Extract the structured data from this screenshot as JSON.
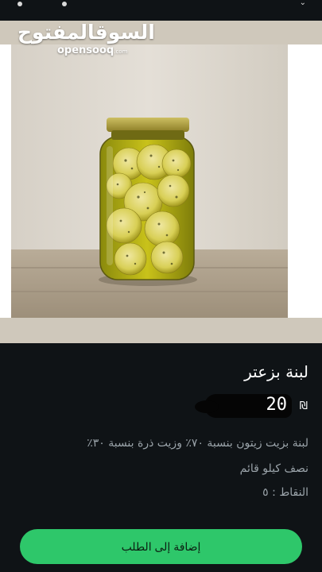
{
  "watermark": {
    "arabic": "السوقالمفتوح",
    "latin": "opensooq",
    "latin_suffix": ".com"
  },
  "product": {
    "title": "لبنة بزعتر",
    "price": "20",
    "currency": "₪",
    "description_lines": [
      "لبنة بزيت زيتون بنسبة ٧٠٪ وزيت ذرة بنسبة ٣٠٪",
      "نصف كيلو قائم",
      "النقاط : ٥"
    ]
  },
  "actions": {
    "add_to_order": "إضافة إلى الطلب"
  },
  "colors": {
    "background": "#0f1316",
    "accent": "#2ec76a",
    "text_secondary": "#9aa3a9"
  }
}
